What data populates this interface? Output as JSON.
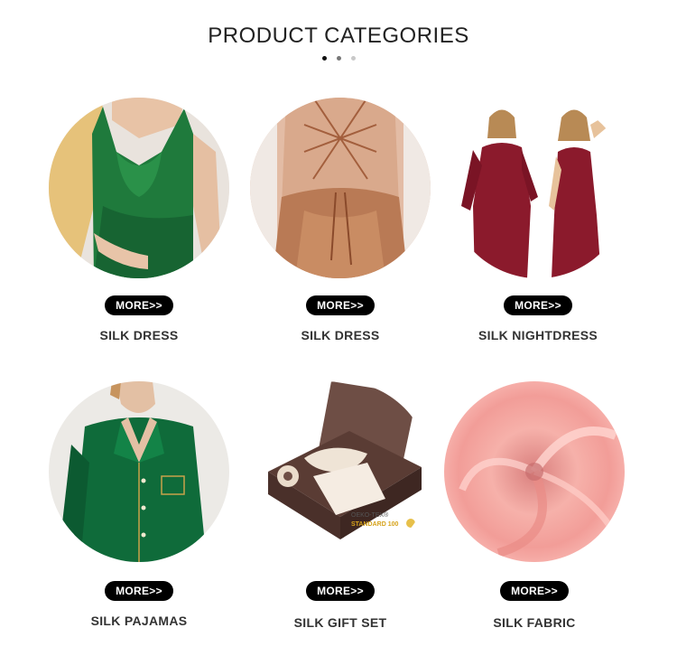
{
  "header": {
    "title": "PRODUCT CATEGORIES",
    "pager_dots": 3
  },
  "more_label": "MORE>>",
  "categories": [
    {
      "label": "SILK DRESS",
      "image": "green-silk-slip-dress",
      "accent": "#1f7a3c"
    },
    {
      "label": "SILK DRESS",
      "image": "champagne-backless-silk-dress",
      "accent": "#b97a55"
    },
    {
      "label": "SILK NIGHTDRESS",
      "image": "burgundy-robe-and-nightdress",
      "accent": "#8b1a2c"
    },
    {
      "label": "SILK PAJAMAS",
      "image": "green-silk-pajama-shirt",
      "accent": "#0f6b3a"
    },
    {
      "label": "SILK GIFT SET",
      "image": "silk-gift-box-set",
      "accent": "#6e4e45",
      "badge": {
        "line1": "OEKO-TEX®",
        "line2": "STANDARD 100"
      }
    },
    {
      "label": "SILK FABRIC",
      "image": "pink-silk-fabric-swirl",
      "accent": "#f2a49f"
    }
  ]
}
